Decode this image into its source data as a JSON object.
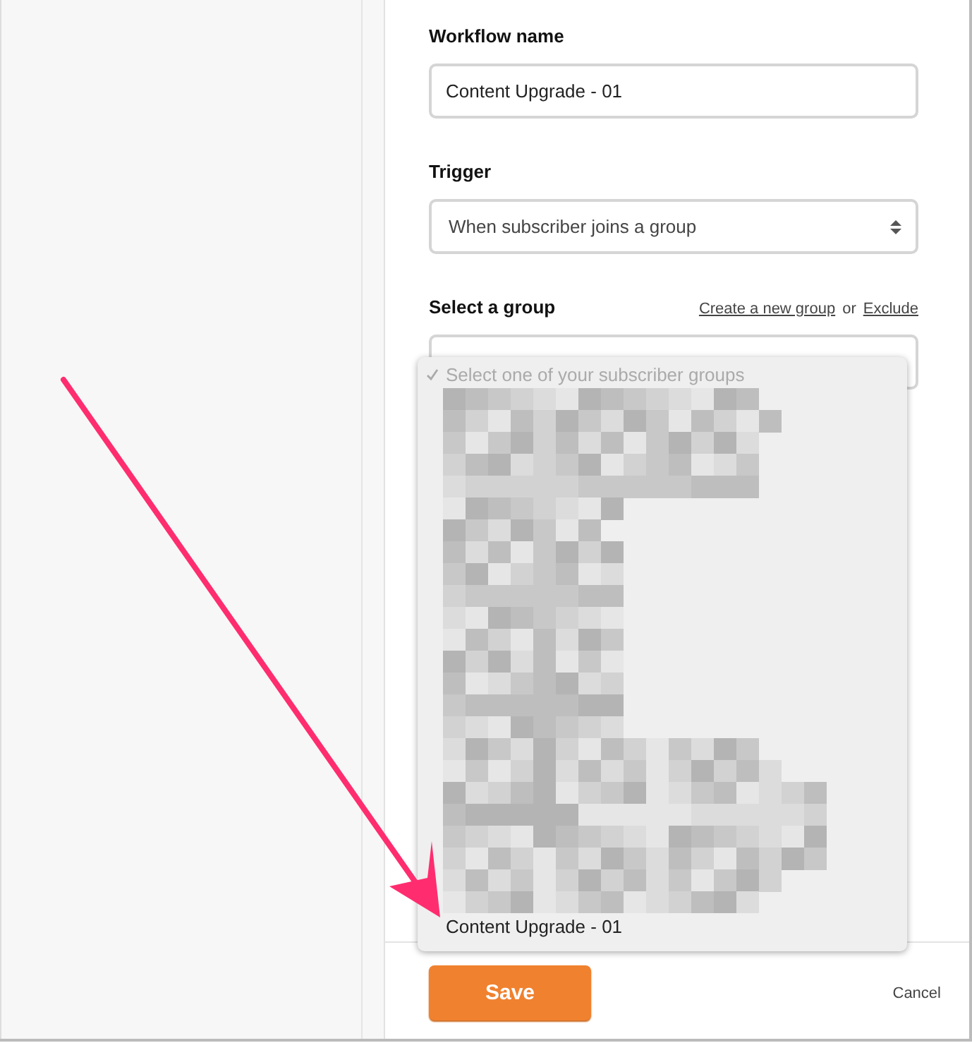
{
  "form": {
    "fields": [
      {
        "kind": "text",
        "label": "Workflow name",
        "value": "Content Upgrade - 01"
      },
      {
        "kind": "select",
        "label": "Trigger",
        "value": "When subscriber joins a group"
      },
      {
        "kind": "group",
        "label": "Select a group",
        "links": [
          "Create a new group",
          "Exclude"
        ],
        "separator": "or"
      }
    ]
  },
  "dropdown": {
    "options": [
      {
        "kind": "option",
        "label": "Select one of your subscriber groups",
        "selected": true,
        "disabled": true
      },
      {
        "kind": "redacted"
      },
      {
        "kind": "option",
        "label": "Content Upgrade - 01",
        "selected": false,
        "disabled": false
      }
    ]
  },
  "buttons": {
    "save": "Save",
    "cancel": "Cancel"
  }
}
